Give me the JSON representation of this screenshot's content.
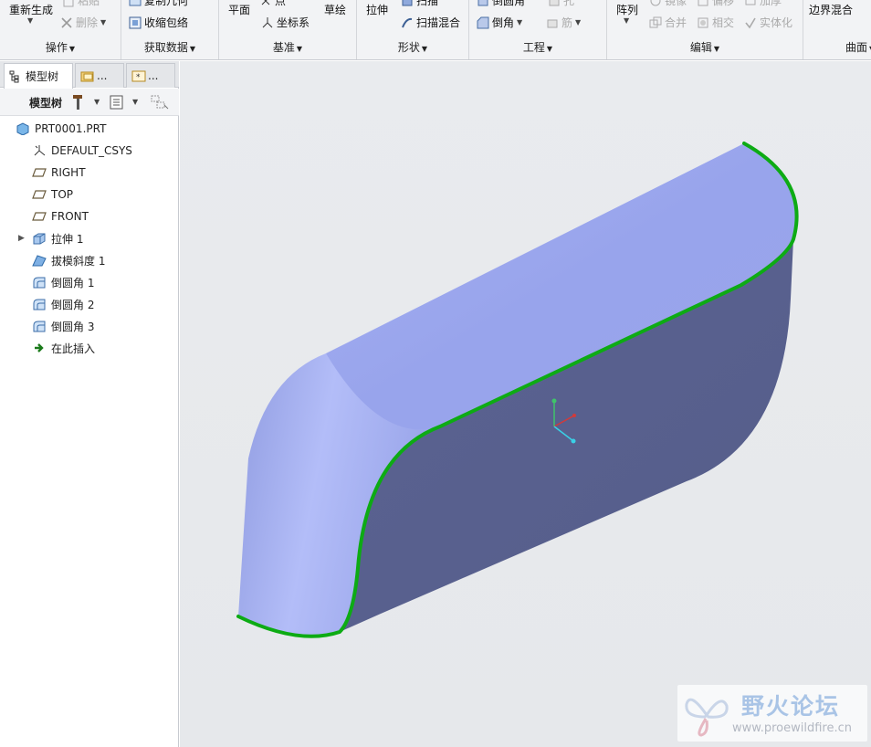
{
  "ribbon": {
    "groups": [
      {
        "id": "ops",
        "label": "操作"
      },
      {
        "id": "getdata",
        "label": "获取数据"
      },
      {
        "id": "datum",
        "label": "基准"
      },
      {
        "id": "shapes",
        "label": "形状"
      },
      {
        "id": "engineering",
        "label": "工程"
      },
      {
        "id": "editing",
        "label": "编辑"
      },
      {
        "id": "surfaces",
        "label": "曲面"
      }
    ],
    "buttons": {
      "regenerate": "重新生成",
      "paste_top": "粘贴",
      "delete": "删除",
      "copy_geom": "复制几何",
      "shrinkwrap": "收缩包络",
      "plane": "平面",
      "point": "点",
      "csys": "坐标系",
      "sketch": "草绘",
      "extrude": "拉伸",
      "sweep": "扫描",
      "swept_blend": "扫描混合",
      "hole": "孔",
      "round_top": "倒圆角",
      "chamfer": "倒角",
      "rib": "筋",
      "pattern": "阵列",
      "mirror": "镜像",
      "offset": "偏移",
      "thicken": "加厚",
      "merge": "合并",
      "intersect": "相交",
      "solidify": "实体化",
      "boundary_blend": "边界混合"
    }
  },
  "panel": {
    "tabs": [
      {
        "label": "模型树"
      },
      {
        "label": "..."
      },
      {
        "label": "..."
      }
    ],
    "toolbar_label": "模型树",
    "tree": [
      {
        "label": "PRT0001.PRT",
        "icon": "part-icon"
      },
      {
        "label": "DEFAULT_CSYS",
        "icon": "csys-icon"
      },
      {
        "label": "RIGHT",
        "icon": "datum-plane-icon"
      },
      {
        "label": "TOP",
        "icon": "datum-plane-icon"
      },
      {
        "label": "FRONT",
        "icon": "datum-plane-icon"
      },
      {
        "label": "拉伸 1",
        "icon": "extrude-icon"
      },
      {
        "label": "拔模斜度 1",
        "icon": "draft-icon"
      },
      {
        "label": "倒圆角 1",
        "icon": "round-icon"
      },
      {
        "label": "倒圆角 2",
        "icon": "round-icon"
      },
      {
        "label": "倒圆角 3",
        "icon": "round-icon"
      },
      {
        "label": "在此插入",
        "icon": "insert-here-icon"
      }
    ]
  },
  "viewport": {
    "highlight_color": "#0dab14",
    "top_face_color": "#98a4ec",
    "side_face_color": "#5a6290"
  },
  "watermark": {
    "title": "野火论坛",
    "url": "www.proewildfire.cn"
  }
}
